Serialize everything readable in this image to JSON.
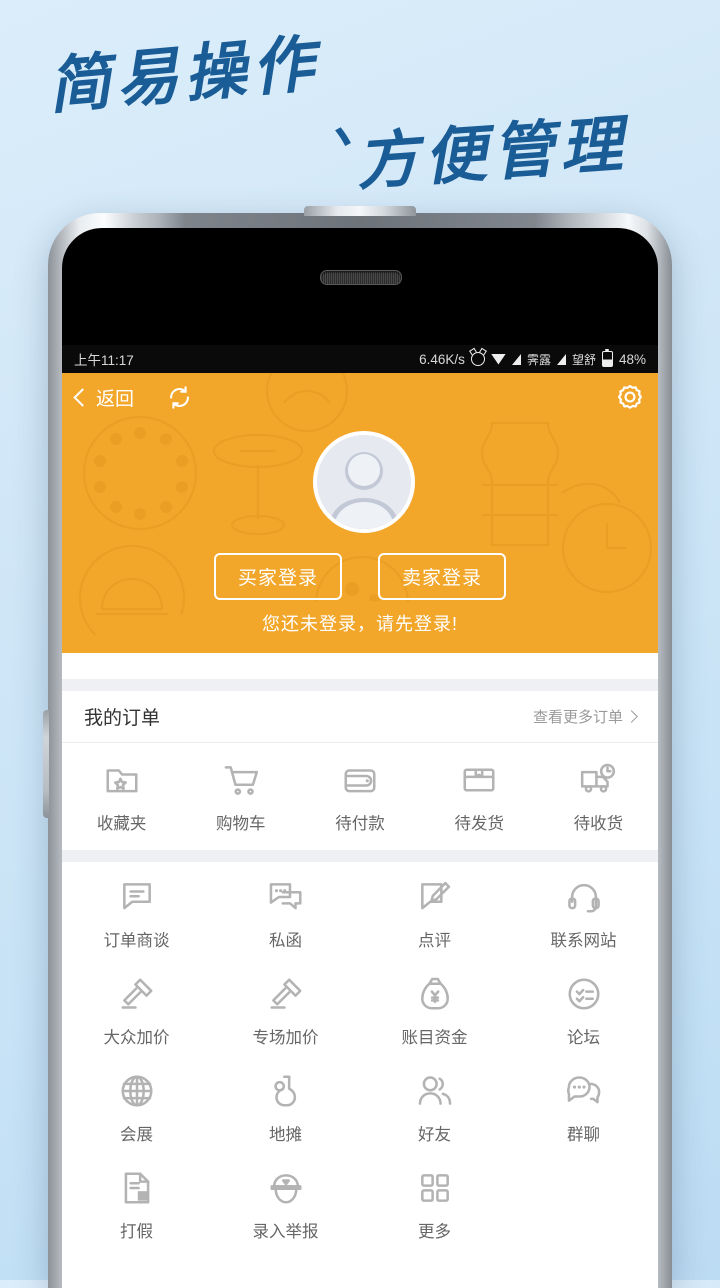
{
  "poster": {
    "headline_line1": "简易操作",
    "headline_comma": "、",
    "headline_line2": "方便管理",
    "headline_color": "#1a5c96",
    "background_color": "#cfe6f7"
  },
  "status_bar": {
    "time": "上午11:17",
    "net_speed": "6.46K/s",
    "alarm_icon": "alarm-icon",
    "wifi_icon": "wifi-icon",
    "signal1_icon": "signal-icon",
    "carrier1": "霁露",
    "signal2_icon": "signal-icon",
    "carrier2": "望舒",
    "battery_icon": "battery-icon",
    "battery": "48%"
  },
  "app_bar": {
    "back_label": "返回",
    "back_icon": "chevron-left-icon",
    "refresh_icon": "refresh-icon",
    "settings_icon": "gear-icon",
    "background_color": "#f2a62a"
  },
  "profile": {
    "avatar_icon": "avatar-placeholder-icon",
    "buyer_login": "买家登录",
    "seller_login": "卖家登录",
    "tip": "您还未登录，请先登录!"
  },
  "orders": {
    "title": "我的订单",
    "more_label": "查看更多订单",
    "more_icon": "chevron-right-icon",
    "items": [
      {
        "label": "收藏夹",
        "icon": "folder-star-icon"
      },
      {
        "label": "购物车",
        "icon": "shopping-cart-icon"
      },
      {
        "label": "待付款",
        "icon": "wallet-icon"
      },
      {
        "label": "待发货",
        "icon": "package-box-icon"
      },
      {
        "label": "待收货",
        "icon": "delivery-truck-icon"
      }
    ]
  },
  "functions": {
    "items": [
      {
        "label": "订单商谈",
        "icon": "chat-lines-icon"
      },
      {
        "label": "私函",
        "icon": "message-dots-icon"
      },
      {
        "label": "点评",
        "icon": "edit-comment-icon"
      },
      {
        "label": "联系网站",
        "icon": "headset-icon"
      },
      {
        "label": "大众加价",
        "icon": "gavel-icon"
      },
      {
        "label": "专场加价",
        "icon": "gavel-icon"
      },
      {
        "label": "账目资金",
        "icon": "money-bag-icon"
      },
      {
        "label": "论坛",
        "icon": "forum-circle-icon"
      },
      {
        "label": "会展",
        "icon": "globe-icon"
      },
      {
        "label": "地摊",
        "icon": "vase-icon"
      },
      {
        "label": "好友",
        "icon": "friends-icon"
      },
      {
        "label": "群聊",
        "icon": "group-chat-icon"
      },
      {
        "label": "打假",
        "icon": "fake-report-icon"
      },
      {
        "label": "录入举报",
        "icon": "police-cap-icon"
      },
      {
        "label": "更多",
        "icon": "grid-more-icon"
      }
    ]
  }
}
